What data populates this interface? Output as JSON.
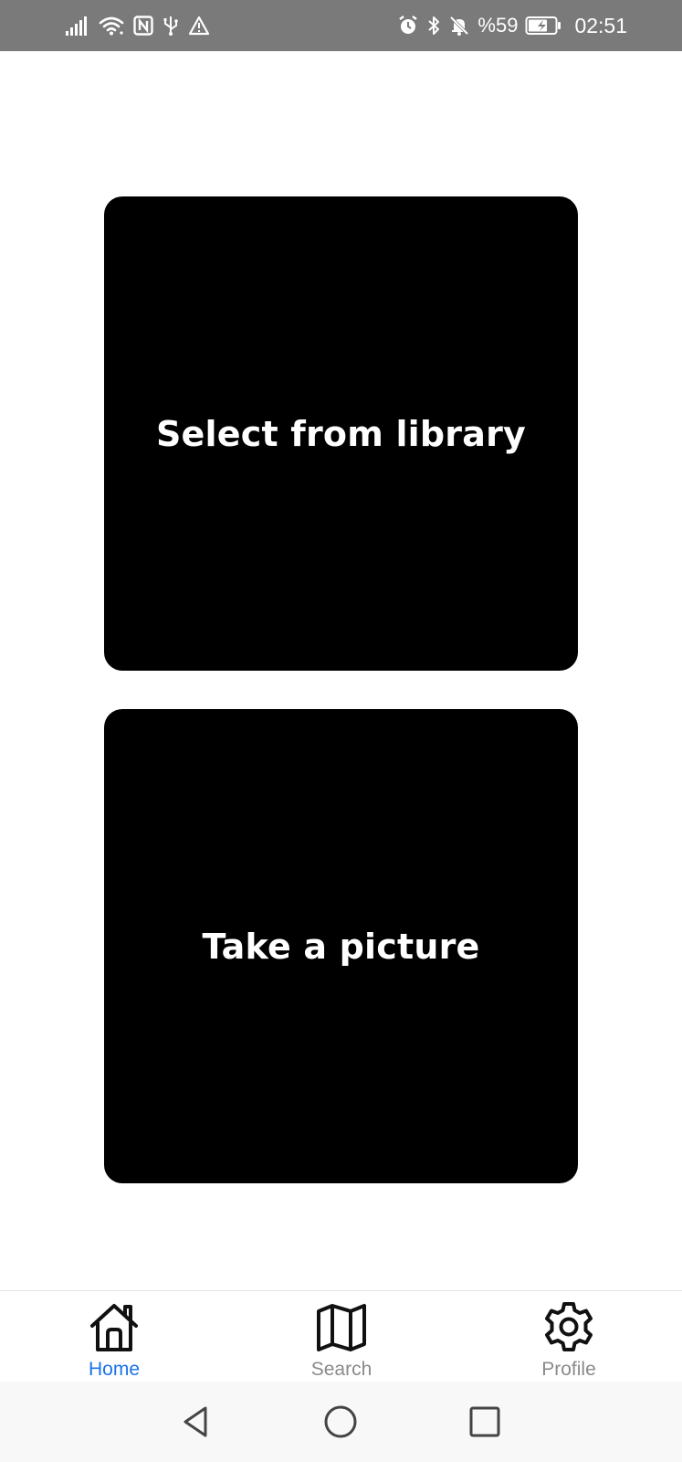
{
  "status_bar": {
    "battery_percent": "%59",
    "time": "02:51",
    "background_color": "#7a7a7a",
    "left_icons": [
      "signal-icon",
      "wifi-icon",
      "nfc-icon",
      "usb-icon",
      "warning-icon"
    ],
    "right_icons": [
      "alarm-icon",
      "bluetooth-icon",
      "bell-off-icon",
      "battery-charging-icon"
    ]
  },
  "main": {
    "tiles": [
      {
        "label": "Select from library"
      },
      {
        "label": "Take a picture"
      }
    ],
    "tile_color": "#000000"
  },
  "tab_bar": {
    "tabs": [
      {
        "label": "Home",
        "icon": "home-icon",
        "active": true
      },
      {
        "label": "Search",
        "icon": "map-icon",
        "active": false
      },
      {
        "label": "Profile",
        "icon": "gear-icon",
        "active": false
      }
    ],
    "active_color": "#1a73e8",
    "inactive_color": "#8a8a8a"
  },
  "nav_bar": {
    "buttons": [
      "back-triangle-icon",
      "home-circle-icon",
      "recents-square-icon"
    ]
  }
}
